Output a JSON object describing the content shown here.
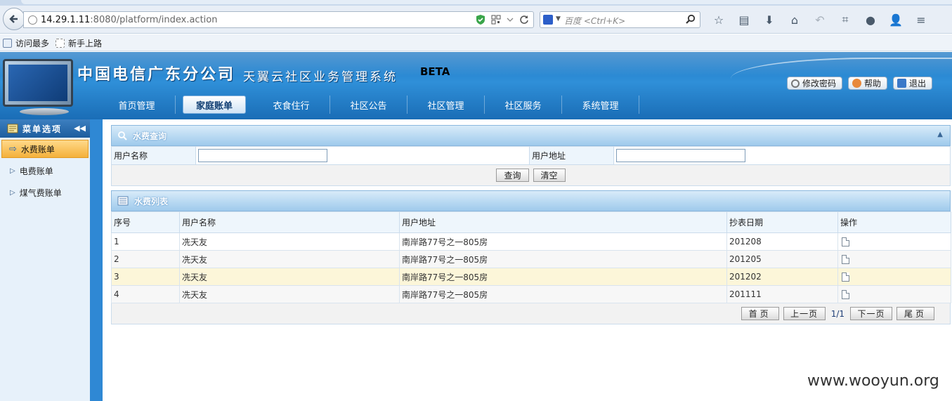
{
  "browser": {
    "url_host": "14.29.1.11",
    "url_rest": ":8080/platform/index.action",
    "search_placeholder": "百度 <Ctrl+K>",
    "bookmarks": [
      "访问最多",
      "新手上路"
    ]
  },
  "header": {
    "title": "中国电信广东分公司",
    "subtitle": "天翼云社区业务管理系统",
    "beta": "BETA",
    "buttons": {
      "change_password": "修改密码",
      "help": "帮助",
      "logout": "退出"
    },
    "nav": [
      "首页管理",
      "家庭账单",
      "衣食住行",
      "社区公告",
      "社区管理",
      "社区服务",
      "系统管理"
    ],
    "nav_active": "家庭账单"
  },
  "sidebar": {
    "title": "菜单选项",
    "items": [
      "水费账单",
      "电费账单",
      "煤气费账单"
    ],
    "active": "水费账单"
  },
  "query_panel": {
    "title": "水费查询",
    "user_name_label": "用户名称",
    "user_name_value": "",
    "user_address_label": "用户地址",
    "user_address_value": "",
    "search_button": "查询",
    "clear_button": "清空"
  },
  "list_panel": {
    "title": "水费列表",
    "columns": [
      "序号",
      "用户名称",
      "用户地址",
      "抄表日期",
      "操作"
    ],
    "rows": [
      {
        "no": "1",
        "name": "冼天友",
        "address": "南岸路77号之一805房",
        "date": "201208"
      },
      {
        "no": "2",
        "name": "冼天友",
        "address": "南岸路77号之一805房",
        "date": "201205"
      },
      {
        "no": "3",
        "name": "冼天友",
        "address": "南岸路77号之一805房",
        "date": "201202"
      },
      {
        "no": "4",
        "name": "冼天友",
        "address": "南岸路77号之一805房",
        "date": "201111"
      }
    ],
    "pager": {
      "first": "首页",
      "prev": "上一页",
      "info": "1/1",
      "next": "下一页",
      "last": "尾页"
    }
  },
  "watermark": "www.wooyun.org",
  "colors": {
    "header_blue": "#2f8fd8",
    "sidebar_active": "#f4b13b",
    "row_highlight": "#fcf6d9"
  }
}
